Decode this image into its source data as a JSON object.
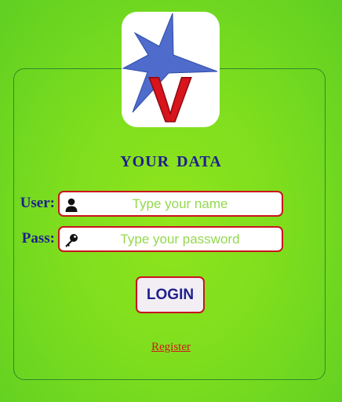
{
  "header": {
    "logo_icon": "star-v-logo-icon",
    "logo_letter": "V"
  },
  "form": {
    "title": "YOUR DATA",
    "user_label": "User:",
    "user_placeholder": "Type your name",
    "user_icon": "user-icon",
    "pass_label": "Pass:",
    "pass_placeholder": "Type your password",
    "pass_icon": "key-icon",
    "login_label": "LOGIN",
    "register_link": "Register"
  },
  "colors": {
    "background": "#7ede1e",
    "text_primary": "#1f1f8c",
    "border_accent": "#c9141c",
    "placeholder": "#94d94f",
    "link": "#d11a1a",
    "star": "#4f6ccc"
  }
}
